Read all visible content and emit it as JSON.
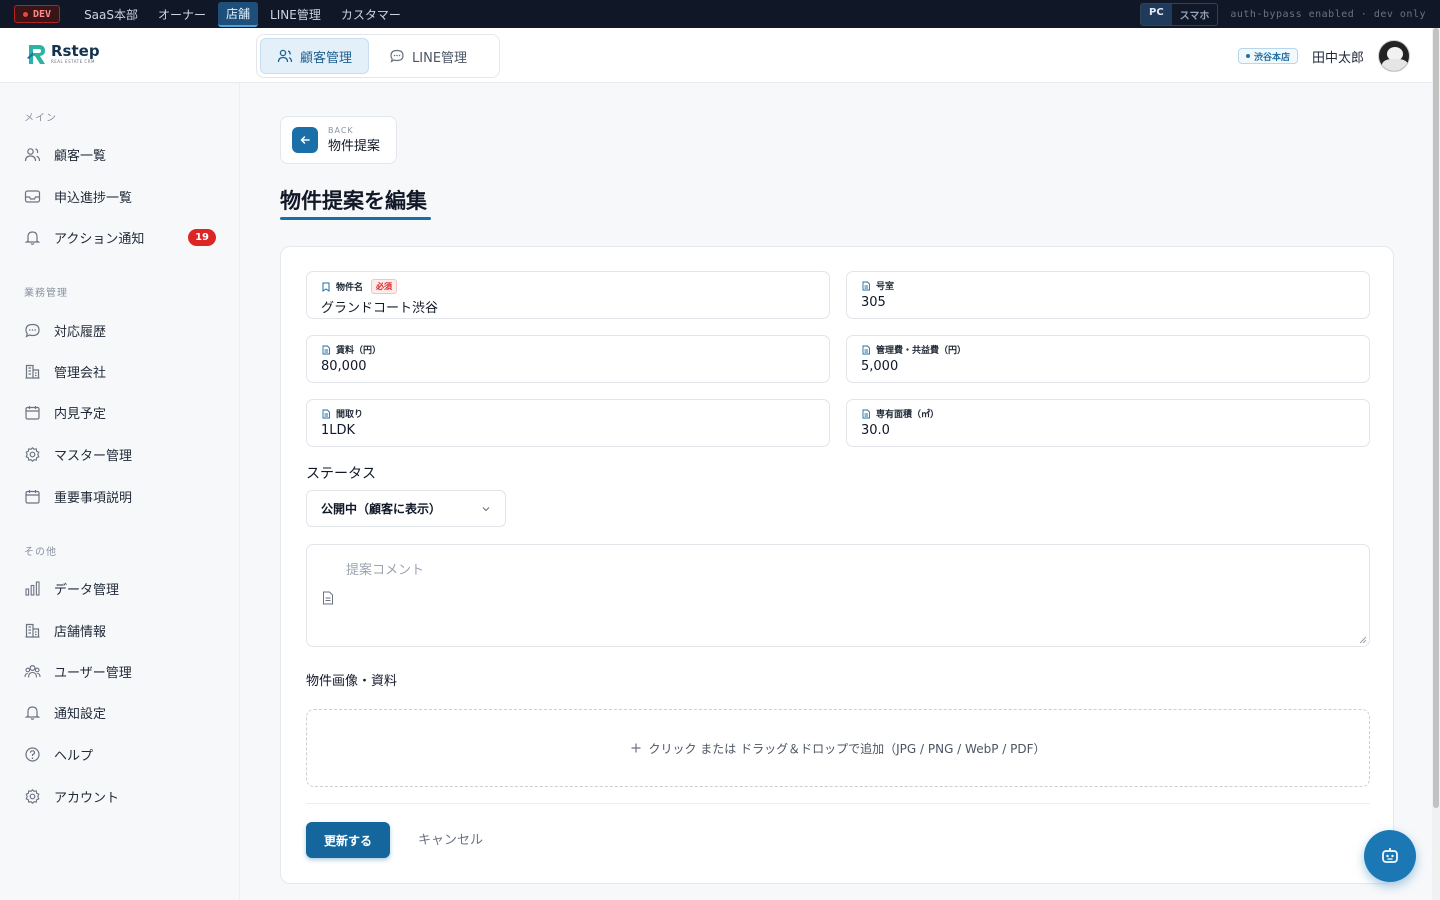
{
  "devbar": {
    "badge": "DEV",
    "nav": [
      "SaaS本部",
      "オーナー",
      "店舗",
      "LINE管理",
      "カスタマー"
    ],
    "active_nav": "店舗",
    "view_pc": "PC",
    "view_mobile": "スマホ",
    "note": "auth-bypass enabled · dev only"
  },
  "header": {
    "logo": "Rstep",
    "logo_sub": "REAL ESTATE CRM",
    "tabs": [
      {
        "label": "顧客管理",
        "active": true
      },
      {
        "label": "LINE管理",
        "active": false
      }
    ],
    "store_badge": "渋谷本店",
    "user_name": "田中太郎"
  },
  "sidebar": {
    "sections": [
      {
        "title": "メイン",
        "items": [
          {
            "label": "顧客一覧",
            "icon": "users-icon"
          },
          {
            "label": "申込進捗一覧",
            "icon": "inbox-icon"
          },
          {
            "label": "アクション通知",
            "icon": "bell-icon",
            "badge": "19"
          }
        ]
      },
      {
        "title": "業務管理",
        "items": [
          {
            "label": "対応履歴",
            "icon": "chat-icon"
          },
          {
            "label": "管理会社",
            "icon": "building-icon"
          },
          {
            "label": "内見予定",
            "icon": "calendar-icon"
          },
          {
            "label": "マスター管理",
            "icon": "gear-icon"
          },
          {
            "label": "重要事項説明",
            "icon": "calendar-icon"
          }
        ]
      },
      {
        "title": "その他",
        "items": [
          {
            "label": "データ管理",
            "icon": "bar-chart-icon"
          },
          {
            "label": "店舗情報",
            "icon": "building-icon"
          },
          {
            "label": "ユーザー管理",
            "icon": "users-icon"
          },
          {
            "label": "通知設定",
            "icon": "bell-icon"
          },
          {
            "label": "ヘルプ",
            "icon": "help-icon"
          },
          {
            "label": "アカウント",
            "icon": "gear-icon"
          }
        ]
      }
    ]
  },
  "back": {
    "small": "BACK",
    "label": "物件提案"
  },
  "page_title": "物件提案を編集",
  "form": {
    "fields": [
      {
        "label": "物件名",
        "value": "グランドコート渋谷",
        "required": "必須"
      },
      {
        "label": "号室",
        "value": "305"
      },
      {
        "label": "賃料（円）",
        "value": "80,000"
      },
      {
        "label": "管理費・共益費（円）",
        "value": "5,000"
      },
      {
        "label": "間取り",
        "value": "1LDK"
      },
      {
        "label": "専有面積（㎡）",
        "value": "30.0"
      }
    ],
    "status_label": "ステータス",
    "status_value": "公開中（顧客に表示）",
    "comment_placeholder": "提案コメント",
    "images_label": "物件画像・資料",
    "dropzone_text": "クリック または ドラッグ＆ドロップで追加（JPG / PNG / WebP / PDF）",
    "submit": "更新する",
    "cancel": "キャンセル"
  },
  "colors": {
    "accent": "#1b6fa8",
    "badge_red": "#dc2626",
    "devbar": "#101827"
  }
}
